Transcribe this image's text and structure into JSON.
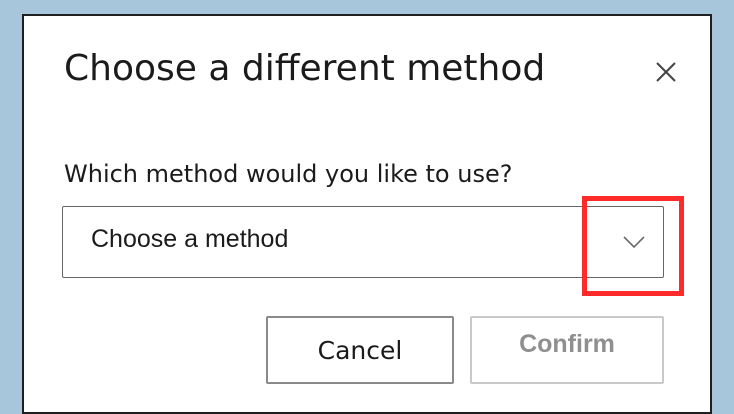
{
  "dialog": {
    "title": "Choose a different method",
    "close_icon": "close-icon",
    "question": "Which method would you like to use?",
    "method_select": {
      "selected_value": "Choose a method",
      "chevron_icon": "chevron-down-icon"
    },
    "buttons": {
      "cancel_label": "Cancel",
      "confirm_label": "Confirm",
      "confirm_disabled": true
    }
  },
  "colors": {
    "page_background": "#a7c6dc",
    "highlight": "#ff2b2b",
    "disabled_text": "#8f8f8f"
  }
}
